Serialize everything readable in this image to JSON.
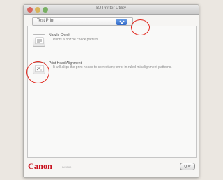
{
  "window": {
    "title": "BJ Printer Utility"
  },
  "toolbar": {
    "select_value": "Test Print"
  },
  "options": [
    {
      "label": "Nozzle Check",
      "description": "Prints a nozzle check pattern.",
      "icon": "nozzle-check-icon"
    },
    {
      "label": "Print Head Alignment",
      "description": "It will align the print heads to correct any error in ruled misalignment patterns.",
      "icon": "print-head-alignment-icon"
    }
  ],
  "footer": {
    "logo": "Canon",
    "version": "BJ i560",
    "exit_label": "Quit"
  },
  "colors": {
    "highlight": "#e1261c",
    "canon_red": "#c8121f",
    "select_blue": "#2e66c7"
  }
}
